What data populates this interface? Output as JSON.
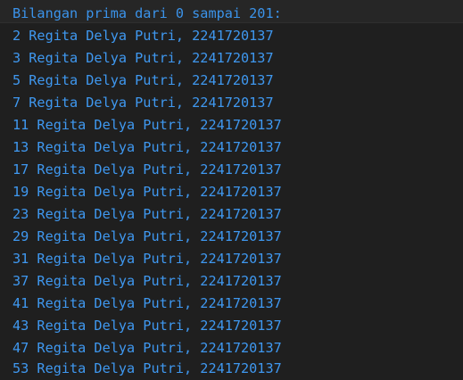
{
  "terminal": {
    "header": "Bilangan prima dari 0 sampai 201:",
    "lines": [
      "2 Regita Delya Putri, 2241720137",
      "3 Regita Delya Putri, 2241720137",
      "5 Regita Delya Putri, 2241720137",
      "7 Regita Delya Putri, 2241720137",
      "11 Regita Delya Putri, 2241720137",
      "13 Regita Delya Putri, 2241720137",
      "17 Regita Delya Putri, 2241720137",
      "19 Regita Delya Putri, 2241720137",
      "23 Regita Delya Putri, 2241720137",
      "29 Regita Delya Putri, 2241720137",
      "31 Regita Delya Putri, 2241720137",
      "37 Regita Delya Putri, 2241720137",
      "41 Regita Delya Putri, 2241720137",
      "43 Regita Delya Putri, 2241720137",
      "47 Regita Delya Putri, 2241720137",
      "53 Regita Delya Putri, 2241720137"
    ],
    "colors": {
      "background": "#1f1f1f",
      "text": "#3f98f0"
    }
  }
}
